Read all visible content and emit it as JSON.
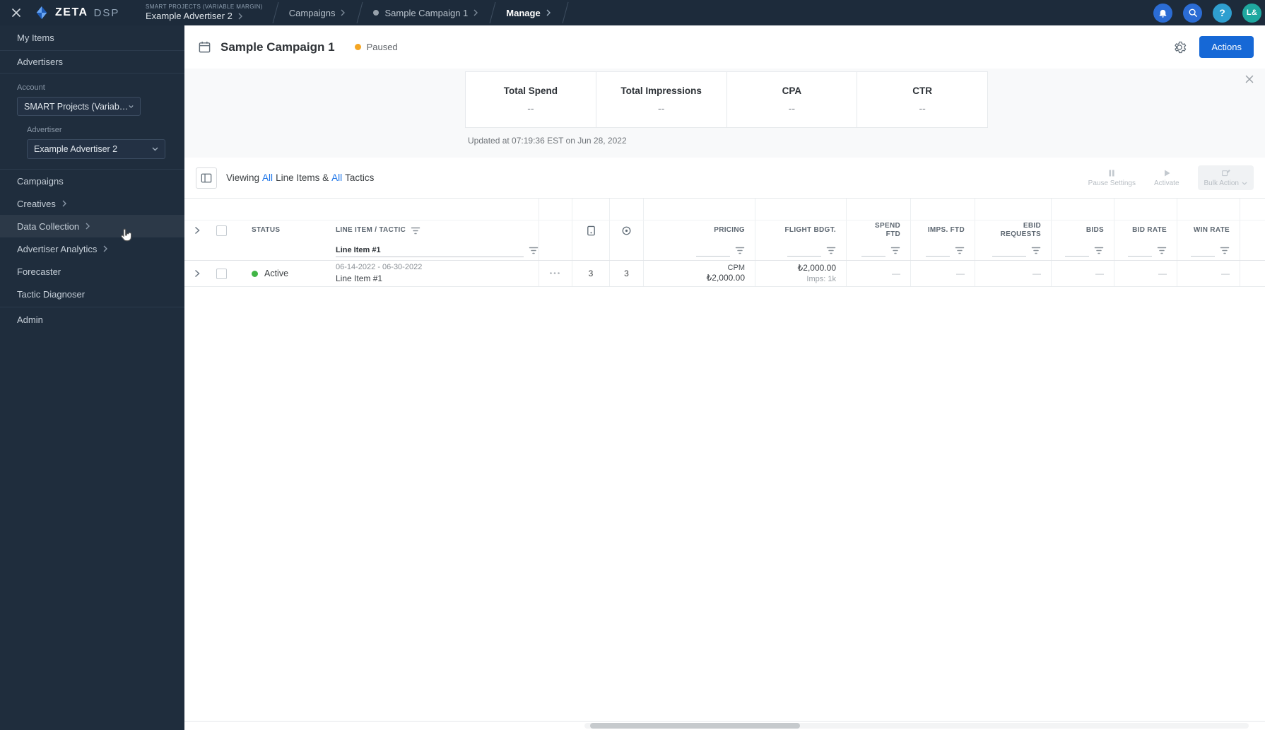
{
  "topbar": {
    "logo_zeta": "ZETA",
    "logo_dsp": "DSP",
    "breadcrumb": {
      "account": "SMART PROJECTS (VARIABLE MARGIN)",
      "advertiser": "Example Advertiser 2",
      "items": [
        "Campaigns",
        "Sample Campaign 1",
        "Manage"
      ]
    },
    "help": "?",
    "avatar": "L&"
  },
  "sidebar": {
    "my_items": "My Items",
    "advertisers": "Advertisers",
    "account_label": "Account",
    "account_value": "SMART Projects (Variable Margin)",
    "advertiser_label": "Advertiser",
    "advertiser_value": "Example Advertiser 2",
    "nav": [
      {
        "label": "Campaigns"
      },
      {
        "label": "Creatives"
      },
      {
        "label": "Data Collection"
      },
      {
        "label": "Advertiser Analytics"
      },
      {
        "label": "Forecaster"
      },
      {
        "label": "Tactic Diagnoser"
      }
    ],
    "admin": "Admin"
  },
  "header": {
    "title": "Sample Campaign 1",
    "status": "Paused",
    "actions": "Actions"
  },
  "stats": {
    "items": [
      {
        "label": "Total Spend",
        "value": "--"
      },
      {
        "label": "Total Impressions",
        "value": "--"
      },
      {
        "label": "CPA",
        "value": "--"
      },
      {
        "label": "CTR",
        "value": "--"
      }
    ],
    "updated": "Updated at 07:19:36 EST on Jun 28, 2022"
  },
  "toolbar": {
    "viewing": {
      "prefix": "Viewing",
      "all_a": "All",
      "mid": "Line Items &",
      "all_b": "All",
      "suffix": "Tactics"
    },
    "pause_settings": "Pause Settings",
    "activate": "Activate",
    "bulk_action": "Bulk Action"
  },
  "table": {
    "headers": [
      "STATUS",
      "LINE ITEM / TACTIC",
      "PRICING",
      "FLIGHT BDGT.",
      "SPEND FTD",
      "IMPS. FTD",
      "EBID REQUESTS",
      "BIDS",
      "BID RATE",
      "WIN RATE"
    ],
    "filter": {
      "line_item": "Line Item #1"
    },
    "menu_icon": "•••",
    "row": {
      "status": "Active",
      "dates": "06-14-2022 - 06-30-2022",
      "name": "Line Item #1",
      "creatives_count": "3",
      "tactics_count": "3",
      "pricing_type": "CPM",
      "pricing_value": "₺2,000.00",
      "flight_budget": "₺2,000.00",
      "flight_imps": "Imps: 1k",
      "spend_ftd": "—",
      "imps_ftd": "—",
      "ebid_requests": "—",
      "bids": "—",
      "bid_rate": "—",
      "win_rate": "—"
    }
  },
  "colors": {
    "topbar_bg": "#1d2b3b",
    "accent_blue": "#1668d6",
    "link_blue": "#1a73e8",
    "paused_orange": "#f5a623",
    "active_green": "#41b546"
  }
}
